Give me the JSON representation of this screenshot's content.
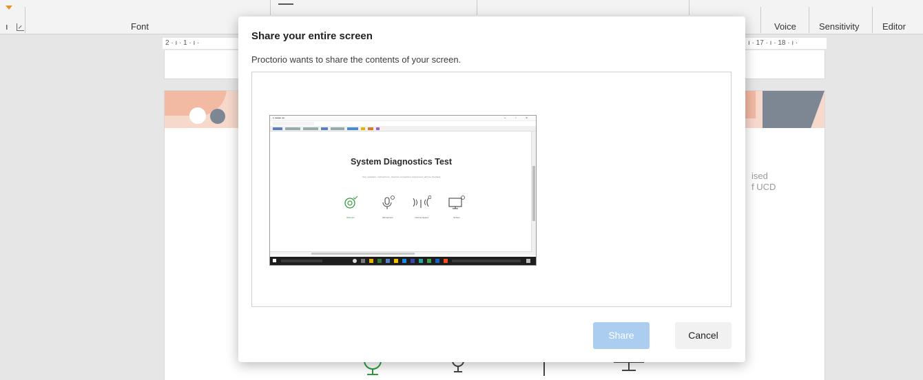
{
  "ribbon": {
    "font_group": "Font",
    "voice": "Voice",
    "sensitivity": "Sensitivity",
    "editor": "Editor"
  },
  "ruler": {
    "left": "2 · ı · 1 · ı ·",
    "right": "ı · 17 · ı · 18 · ı ·"
  },
  "document": {
    "text_line1": "ised",
    "text_line2": "f UCD"
  },
  "dialog": {
    "title": "Share your entire screen",
    "description": "Proctorio wants to share the contents of your screen.",
    "share_label": "Share",
    "cancel_label": "Cancel",
    "share_disabled_color": "#aacdf0"
  },
  "preview": {
    "heading": "System Diagnostics Test",
    "subtitle": "Your webcam, microphone, internet connection and screen will be checked",
    "check_labels": [
      "Webcam",
      "Microphone",
      "Internet Speed",
      "Screen"
    ],
    "active_color": "#2e9a3d"
  }
}
